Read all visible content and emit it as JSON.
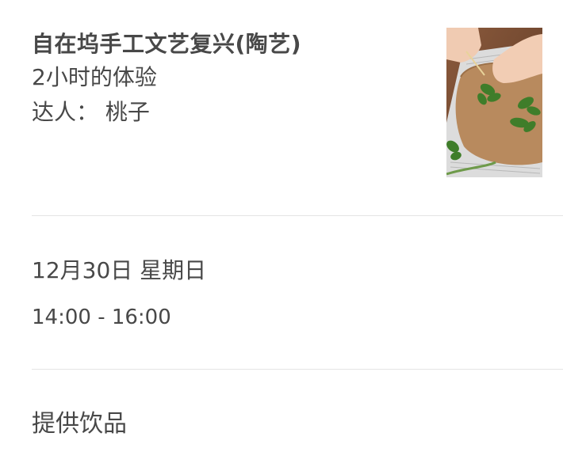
{
  "experience": {
    "title": "自在坞手工文艺复兴(陶艺)",
    "duration": "2小时的体验",
    "host": "达人：  桃子"
  },
  "schedule": {
    "date": "12月30日 星期日",
    "time": "14:00 - 16:00"
  },
  "amenities": {
    "item": "提供饮品"
  },
  "colors": {
    "text": "#484848",
    "divider": "#e4e4e4"
  },
  "icons": {
    "thumbnail": "craft-photo-thumbnail"
  }
}
